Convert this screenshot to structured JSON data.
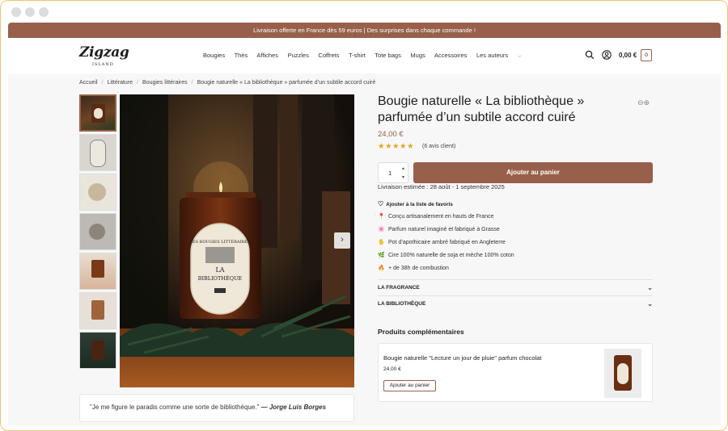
{
  "promo": {
    "text": "Livraison offerte en France dès 59 euros | Des surprises dans chaque commande !"
  },
  "header": {
    "logo_main": "Zigzag",
    "logo_sub": "ISLAND",
    "nav": [
      "Bougies",
      "Thés",
      "Affiches",
      "Puzzles",
      "Coffrets",
      "T-shirt",
      "Tote bags",
      "Mugs",
      "Accessoires",
      "Les auteurs"
    ],
    "cart_total": "0,00 €",
    "cart_count": "0"
  },
  "breadcrumb": [
    "Accueil",
    "Littérature",
    "Bougies littéraires",
    "Bougie naturelle « La bibliothèque » parfumée d’un subtile accord cuiré"
  ],
  "gallery": {
    "thumb_count": 7,
    "next_arrow": "›",
    "label_line1": "LES BOUGIES LITTÉRAIRES",
    "label_line2": "LA",
    "label_line3": "BIBLIOTHÈQUE"
  },
  "quote": {
    "text": "\"Je me figure le paradis comme une sorte de bibliothèque.\"",
    "author": "— Jorge Luis Borges"
  },
  "product": {
    "title": "Bougie naturelle « La bibliothèque » parfumée d’un subtile accord cuiré",
    "price": "24,00 €",
    "rating": 5,
    "stars": "★★★★★",
    "reviews": "(6 avis client)",
    "quantity": "1",
    "add_to_cart": "Ajouter au panier",
    "delivery": "Livraison estimée : 28 août - 1 septembre 2025",
    "wishlist": "Ajouter à la liste de favoris",
    "features": [
      {
        "icon": "pin-icon",
        "glyph": "📍",
        "text": "Conçu artisanalement en hauts de France"
      },
      {
        "icon": "flower-icon",
        "glyph": "🌸",
        "text": "Parfum naturel imaginé et fabriqué à Grasse"
      },
      {
        "icon": "hand-icon",
        "glyph": "✋",
        "text": "Pot d’apothicaire ambré fabriqué en Angleterre"
      },
      {
        "icon": "leaf-icon",
        "glyph": "🌿",
        "text": "Cire 100% naturelle de soja et mèche 100% coton"
      },
      {
        "icon": "flame-icon",
        "glyph": "🔥",
        "text": "+ de 38h de combustion"
      }
    ],
    "accordions": [
      "LA FRAGRANCE",
      "LA BIBLIOTHÈQUE"
    ]
  },
  "related": {
    "title": "Produits complémentaires",
    "items": [
      {
        "name": "Bougie naturelle \"Lecture un jour de pluie\" parfum chocolat",
        "price": "24,00 €",
        "button": "Ajouter au panier"
      }
    ]
  },
  "colors": {
    "brand": "#98604a",
    "stars": "#e2a322"
  }
}
